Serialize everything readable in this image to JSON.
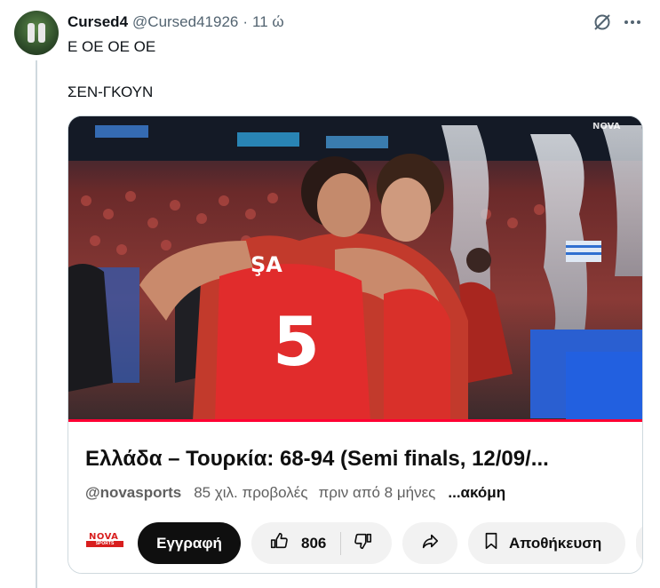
{
  "tweet": {
    "name": "Cursed4",
    "handle": "@Cursed41926",
    "separator": "·",
    "time": "11 ώ",
    "text_line1": "Ε ΟΕ ΟΕ ΟΕ",
    "text_line2": "ΣΕΝ-ΓΚΟΥΝ"
  },
  "video": {
    "overlay_logo": "NOVA",
    "jersey_number": "5",
    "jersey_name": "ŞA",
    "title": "Ελλάδα – Τουρκία: 68-94 (Semi finals, 12/09/...",
    "channel": "@novasports",
    "views": "85 χιλ. προβολές",
    "age": "πριν από 8 μήνες",
    "more": "...ακόμη",
    "channel_logo_top": "NOVA",
    "channel_logo_bottom": "SPORTS",
    "subscribe_label": "Εγγραφή",
    "like_count": "806",
    "save_label": "Αποθήκευση",
    "accent_color": "#ff0033"
  }
}
